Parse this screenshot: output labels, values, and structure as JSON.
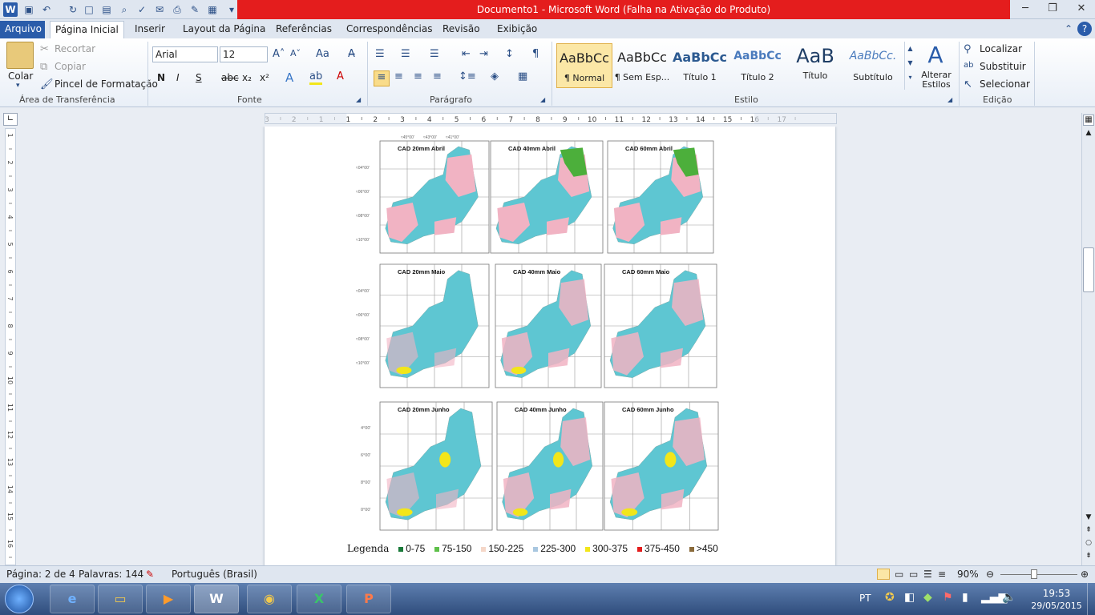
{
  "window": {
    "title": "Documento1 - Microsoft Word (Falha na Ativação do Produto)"
  },
  "tabs": [
    "Arquivo",
    "Página Inicial",
    "Inserir",
    "Layout da Página",
    "Referências",
    "Correspondências",
    "Revisão",
    "Exibição"
  ],
  "clipboard": {
    "paste": "Colar",
    "cut": "Recortar",
    "copy": "Copiar",
    "format_painter": "Pincel de Formatação",
    "group": "Área de Transferência"
  },
  "font": {
    "name": "Arial",
    "size": "12",
    "group": "Fonte",
    "bold": "N",
    "italic": "I",
    "underline": "S",
    "strike": "abc",
    "sub": "x₂",
    "sup": "x²"
  },
  "paragraph": {
    "group": "Parágrafo"
  },
  "styles": {
    "group": "Estilo",
    "items": [
      {
        "preview": "AaBbCc",
        "name": "¶ Normal"
      },
      {
        "preview": "AaBbCc",
        "name": "¶ Sem Esp..."
      },
      {
        "preview": "AaBbCc",
        "name": "Título 1"
      },
      {
        "preview": "AaBbCc",
        "name": "Título 2"
      },
      {
        "preview": "AaB",
        "name": "Título"
      },
      {
        "preview": "AaBbCc.",
        "name": "Subtítulo"
      }
    ],
    "change": "Alterar Estilos"
  },
  "editing": {
    "group": "Edição",
    "find": "Localizar",
    "replace": "Substituir",
    "select": "Selecionar"
  },
  "ruler_h": [
    "3",
    "2",
    "1",
    "1",
    "2",
    "3",
    "4",
    "5",
    "6",
    "7",
    "8",
    "9",
    "10",
    "11",
    "12",
    "13",
    "14",
    "15",
    "16",
    "17"
  ],
  "ruler_v": [
    "1",
    "2",
    "3",
    "4",
    "5",
    "6",
    "7",
    "8",
    "9",
    "10",
    "11",
    "12",
    "13",
    "14",
    "15",
    "16"
  ],
  "maps": [
    {
      "title": "CAD 20mm   Abril"
    },
    {
      "title": "CAD 40mm   Abril"
    },
    {
      "title": "CAD 60mm   Abril"
    },
    {
      "title": "CAD 20mm   Maio"
    },
    {
      "title": "CAD 40mm   Maio"
    },
    {
      "title": "CAD 60mm   Maio"
    },
    {
      "title": "CAD 20mm   Junho"
    },
    {
      "title": "CAD 40mm   Junho"
    },
    {
      "title": "CAD 60mm   Junho"
    }
  ],
  "map_coords": {
    "top": [
      "≈45°00'",
      "≈43°00'",
      "≈41°00'"
    ],
    "left": [
      "≈04°00'",
      "≈06°00'",
      "≈08°00'",
      "≈10°00'"
    ],
    "left_june": [
      "4°00'",
      "6°00'",
      "8°00'",
      "0°00'"
    ]
  },
  "legend": {
    "label": "Legenda",
    "items": [
      {
        "text": "0-75",
        "color": "#1a7a3a"
      },
      {
        "text": "75-150",
        "color": "#5ec04a"
      },
      {
        "text": "150-225",
        "color": "#f5d7c8"
      },
      {
        "text": "225-300",
        "color": "#a9c7e0"
      },
      {
        "text": "300-375",
        "color": "#f2e61a"
      },
      {
        "text": "375-450",
        "color": "#e41d1d"
      },
      {
        "text": ">450",
        "color": "#8a6a3a"
      }
    ]
  },
  "status": {
    "page": "Página: 2 de 4",
    "words": "Palavras: 144",
    "language": "Português (Brasil)",
    "zoom": "90%"
  },
  "taskbar": {
    "lang": "PT",
    "time": "19:53",
    "date": "29/05/2015"
  },
  "colors": {
    "ocean": "#5ec6d2",
    "pink": "#f1b3c3",
    "green": "#4caf3b",
    "yellow": "#f2e61a",
    "accent": "#2a5caa",
    "title_bar_red": "#e41d1d"
  }
}
